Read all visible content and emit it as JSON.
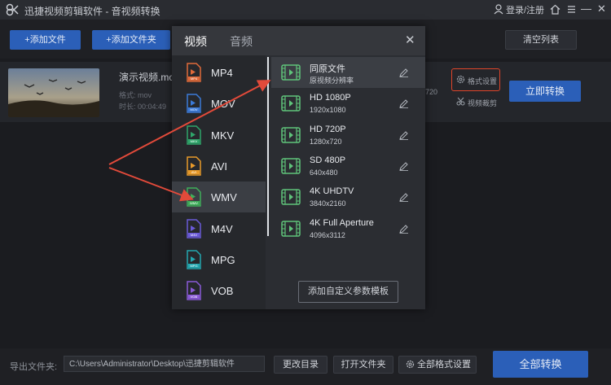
{
  "app": {
    "title": "迅捷视频剪辑软件 - 音视频转换",
    "login": "登录/注册"
  },
  "toolbar": {
    "add_file": "+添加文件",
    "add_folder": "+添加文件夹",
    "clear_list": "清空列表"
  },
  "file": {
    "name": "演示视频.mov",
    "format_label": "格式: mov",
    "duration_label": "时长: 00:04:49",
    "resolution_partial": "720",
    "format_settings": "格式设置",
    "convert_now": "立即转换",
    "video_crop": "视频裁剪"
  },
  "dialog": {
    "tabs": [
      "视频",
      "音频"
    ],
    "formats": [
      {
        "label": "MP4",
        "color": "#e06a3a"
      },
      {
        "label": "MOV",
        "color": "#3b7ad8"
      },
      {
        "label": "MKV",
        "color": "#2fa56a"
      },
      {
        "label": "AVI",
        "color": "#e89a2a"
      },
      {
        "label": "WMV",
        "color": "#3fae5a"
      },
      {
        "label": "M4V",
        "color": "#6a5ad8"
      },
      {
        "label": "MPG",
        "color": "#23a7b0"
      },
      {
        "label": "VOB",
        "color": "#8a5ad8"
      }
    ],
    "selected_format": "WMV",
    "resolutions": [
      {
        "name": "同原文件",
        "detail": "原视频分辨率"
      },
      {
        "name": "HD 1080P",
        "detail": "1920x1080"
      },
      {
        "name": "HD 720P",
        "detail": "1280x720"
      },
      {
        "name": "SD 480P",
        "detail": "640x480"
      },
      {
        "name": "4K UHDTV",
        "detail": "3840x2160"
      },
      {
        "name": "4K Full Aperture",
        "detail": "4096x3112"
      }
    ],
    "add_template": "添加自定义参数模板"
  },
  "footer": {
    "output_label": "导出文件夹:",
    "output_path": "C:\\Users\\Administrator\\Desktop\\迅捷剪辑软件",
    "change_dir": "更改目录",
    "open_folder": "打开文件夹",
    "all_format_settings": "全部格式设置",
    "convert_all": "全部转换"
  },
  "colors": {
    "accent": "#2b5fb8",
    "highlight": "#e0452a",
    "arrow": "#e24a3a"
  }
}
